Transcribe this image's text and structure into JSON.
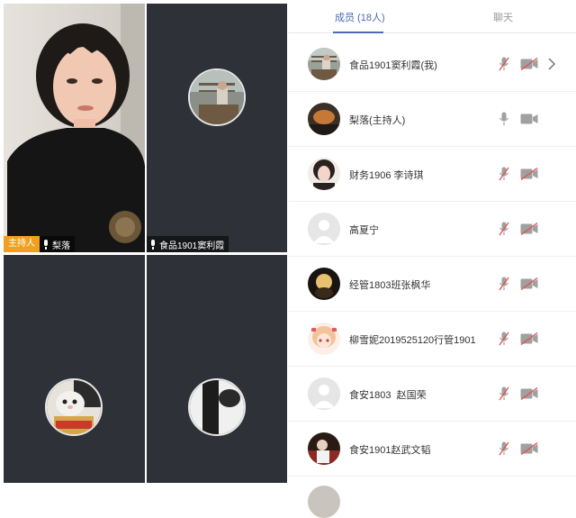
{
  "video_grid": {
    "tile1": {
      "host_tag": "主持人",
      "name": "梨落"
    },
    "tile2": {
      "name": "食品1901窦利霞"
    }
  },
  "tabs": {
    "members": "成员 (18人)",
    "chat": "聊天"
  },
  "members": [
    {
      "name": "食品1901窦利霞(我)",
      "mic_muted": true,
      "cam_off": true,
      "chevron": true
    },
    {
      "name": "梨落(主持人)",
      "mic_muted": false,
      "cam_off": false
    },
    {
      "name": "财务1906 李诗琪",
      "mic_muted": true,
      "cam_off": true
    },
    {
      "name": "高夏宁",
      "mic_muted": true,
      "cam_off": true
    },
    {
      "name": "经管1803班张枫华",
      "mic_muted": true,
      "cam_off": true
    },
    {
      "name": "柳雪妮2019525120行管1901",
      "mic_muted": true,
      "cam_off": true
    },
    {
      "name": "食安1803  赵国荣",
      "mic_muted": true,
      "cam_off": true
    },
    {
      "name": "食安1901赵武文韬",
      "mic_muted": true,
      "cam_off": true
    }
  ],
  "colors": {
    "accent": "#4a6ab2",
    "host_tag": "#f0a020",
    "muted_red": "#e05050",
    "icon_gray": "#a0a0a0",
    "tile_bg": "#2e3137"
  }
}
